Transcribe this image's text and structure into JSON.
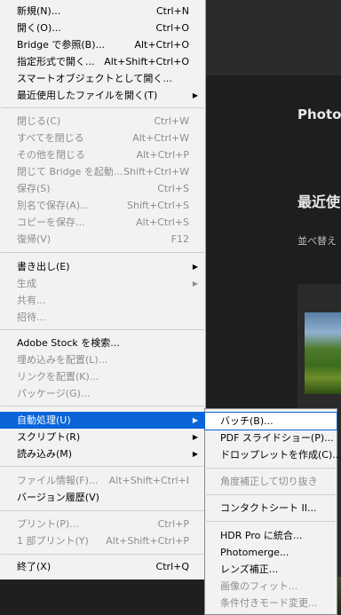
{
  "background": {
    "app_title": "Photos",
    "recent_heading": "最近使",
    "sort_label": "並べ替え"
  },
  "menu": {
    "items": [
      {
        "label": "新規(N)...",
        "shortcut": "Ctrl+N"
      },
      {
        "label": "開く(O)...",
        "shortcut": "Ctrl+O"
      },
      {
        "label": "Bridge で参照(B)...",
        "shortcut": "Alt+Ctrl+O"
      },
      {
        "label": "指定形式で開く...",
        "shortcut": "Alt+Shift+Ctrl+O"
      },
      {
        "label": "スマートオブジェクトとして開く...",
        "shortcut": ""
      },
      {
        "label": "最近使用したファイルを開く(T)",
        "shortcut": ""
      },
      {
        "label": "閉じる(C)",
        "shortcut": "Ctrl+W"
      },
      {
        "label": "すべてを閉じる",
        "shortcut": "Alt+Ctrl+W"
      },
      {
        "label": "その他を閉じる",
        "shortcut": "Alt+Ctrl+P"
      },
      {
        "label": "閉じて Bridge を起動...",
        "shortcut": "Shift+Ctrl+W"
      },
      {
        "label": "保存(S)",
        "shortcut": "Ctrl+S"
      },
      {
        "label": "別名で保存(A)...",
        "shortcut": "Shift+Ctrl+S"
      },
      {
        "label": "コピーを保存...",
        "shortcut": "Alt+Ctrl+S"
      },
      {
        "label": "復帰(V)",
        "shortcut": "F12"
      },
      {
        "label": "書き出し(E)",
        "shortcut": ""
      },
      {
        "label": "生成",
        "shortcut": ""
      },
      {
        "label": "共有...",
        "shortcut": ""
      },
      {
        "label": "招待...",
        "shortcut": ""
      },
      {
        "label": "Adobe Stock を検索...",
        "shortcut": ""
      },
      {
        "label": "埋め込みを配置(L)...",
        "shortcut": ""
      },
      {
        "label": "リンクを配置(K)...",
        "shortcut": ""
      },
      {
        "label": "パッケージ(G)...",
        "shortcut": ""
      },
      {
        "label": "自動処理(U)",
        "shortcut": ""
      },
      {
        "label": "スクリプト(R)",
        "shortcut": ""
      },
      {
        "label": "読み込み(M)",
        "shortcut": ""
      },
      {
        "label": "ファイル情報(F)...",
        "shortcut": "Alt+Shift+Ctrl+I"
      },
      {
        "label": "バージョン履歴(V)",
        "shortcut": ""
      },
      {
        "label": "プリント(P)...",
        "shortcut": "Ctrl+P"
      },
      {
        "label": "1 部プリント(Y)",
        "shortcut": "Alt+Shift+Ctrl+P"
      },
      {
        "label": "終了(X)",
        "shortcut": "Ctrl+Q"
      }
    ]
  },
  "submenu": {
    "items": [
      {
        "label": "バッチ(B)..."
      },
      {
        "label": "PDF スライドショー(P)..."
      },
      {
        "label": "ドロップレットを作成(C)..."
      },
      {
        "label": "角度補正して切り抜き"
      },
      {
        "label": "コンタクトシート II..."
      },
      {
        "label": "HDR Pro に統合..."
      },
      {
        "label": "Photomerge..."
      },
      {
        "label": "レンズ補正..."
      },
      {
        "label": "画像のフィット..."
      },
      {
        "label": "条件付きモード変更..."
      }
    ]
  }
}
